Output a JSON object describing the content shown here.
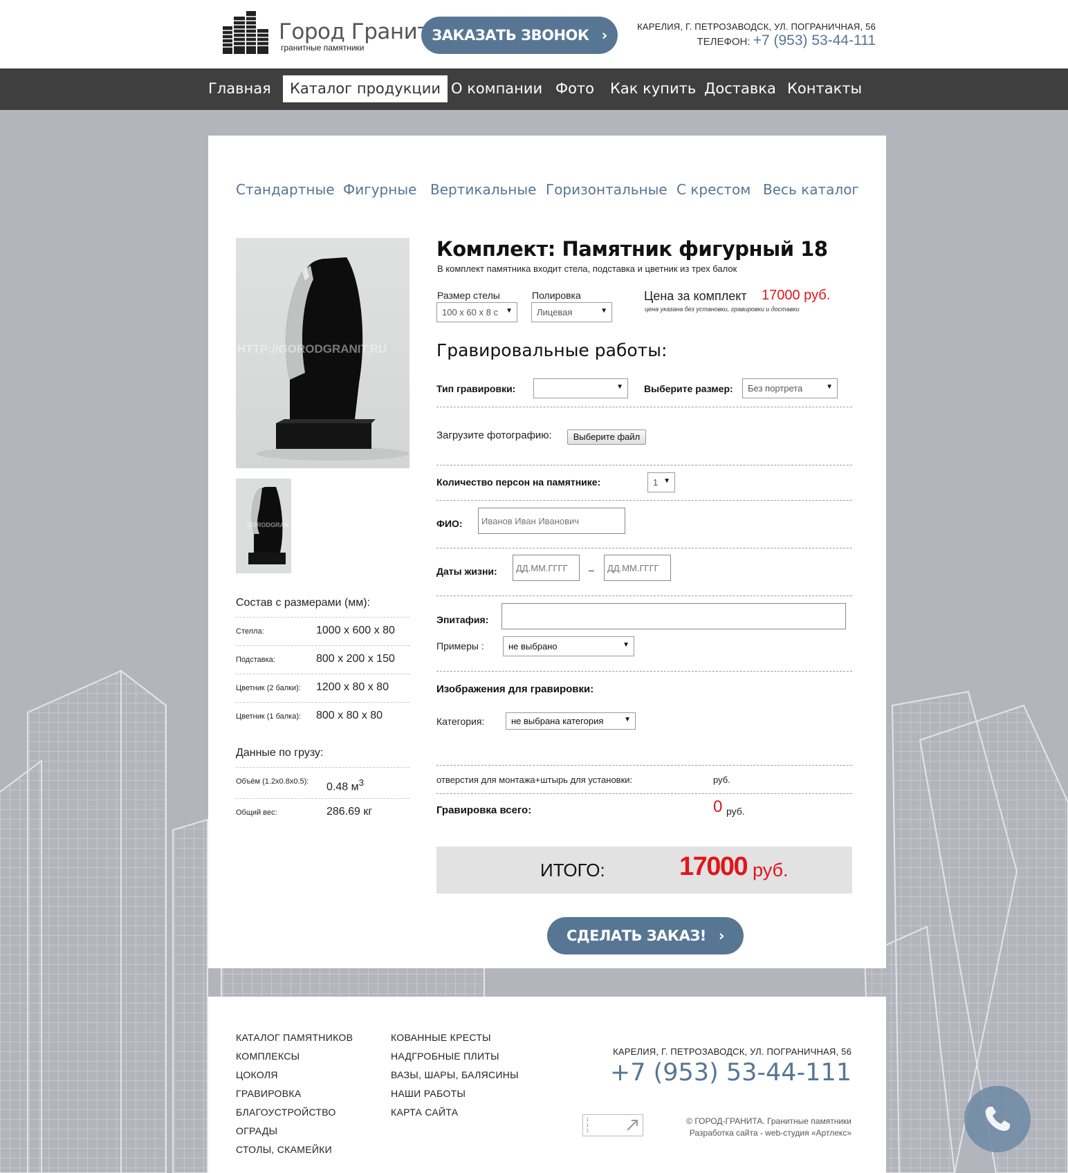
{
  "header": {
    "logo_title": "Город Гранит",
    "logo_subtitle": "гранитные памятники",
    "call_button": "ЗАКАЗАТЬ ЗВОНОК",
    "address": "КАРЕЛИЯ, Г. ПЕТРОЗАВОДСК, УЛ. ПОГРАНИЧНАЯ, 56",
    "phone_label": "ТЕЛЕФОН:",
    "phone": "+7 (953) 53-44-111"
  },
  "nav": {
    "items": [
      {
        "label": "Главная",
        "active": false
      },
      {
        "label": "Каталог продукции",
        "active": true
      },
      {
        "label": "О компании",
        "active": false
      },
      {
        "label": "Фото",
        "active": false
      },
      {
        "label": "Как купить",
        "active": false
      },
      {
        "label": "Доставка",
        "active": false
      },
      {
        "label": "Контакты",
        "active": false
      }
    ]
  },
  "subnav": {
    "items": [
      "Стандартные",
      "Фигурные",
      "Вертикальные",
      "Горизонтальные",
      "С крестом",
      "Весь каталог"
    ]
  },
  "gallery": {
    "watermark": "HTTP://GORODGRANIT.RU",
    "thumb_watermark": "GORODGRAN"
  },
  "specs": {
    "title": "Состав с размерами (мм):",
    "rows": [
      {
        "key": "Стелла:",
        "value": "1000 x 600 x 80"
      },
      {
        "key": "Подставка:",
        "value": "800 x 200 x 150"
      },
      {
        "key": "Цветник (2 балки):",
        "value": "1200 x 80 x 80"
      },
      {
        "key": "Цветник (1 балка):",
        "value": "800 x 80 x 80"
      }
    ],
    "cargo_title": "Данные по грузу:",
    "cargo_rows": [
      {
        "key": "Объём (1.2x0.8x0.5):",
        "value": "0.48 м",
        "sup": "3"
      },
      {
        "key": "Общий вес:",
        "value": "286.69 кг",
        "sup": ""
      }
    ]
  },
  "product": {
    "title": "Комплект: Памятник фигурный 18",
    "description": "В комплект памятника входит стела, подставка и цветник из трех балок",
    "size_label": "Размер стелы",
    "size_value": "100 x 60 x 8 с",
    "polish_label": "Полировка",
    "polish_value": "Лицевая",
    "price_label": "Цена за комплект",
    "price_value": "17000 руб.",
    "price_note": "цена указана без установки, гравировки и доставки"
  },
  "engraving": {
    "heading": "Гравировальные работы:",
    "type_label": "Тип гравировки:",
    "type_value": "",
    "size_label": "Выберите размер:",
    "size_value": "Без портрета",
    "upload_label": "Загрузите фотографию:",
    "upload_button": "Выберите файл",
    "persons_label": "Количество персон на памятнике:",
    "persons_value": "1",
    "fio_label": "ФИО:",
    "fio_placeholder": "Иванов Иван Иванович",
    "dates_label": "Даты жизни:",
    "date_placeholder": "ДД.ММ.ГГГГ",
    "date_dash": "–",
    "epitaph_label": "Эпитафия:",
    "examples_label": "Примеры :",
    "examples_value": "не выбрано",
    "images_heading": "Изображения для гравировки:",
    "category_label": "Категория:",
    "category_value": "не выбрана категория",
    "holes_label": "отверстия для монтажа+штырь для установки:",
    "holes_value": "руб.",
    "total_label": "Гравировка всего:",
    "total_value": "0",
    "total_currency": "руб."
  },
  "totals": {
    "label": "ИТОГО:",
    "value": "17000",
    "currency": "руб."
  },
  "order_button": "СДЕЛАТЬ ЗАКАЗ!",
  "footer": {
    "col1": [
      "КАТАЛОГ ПАМЯТНИКОВ",
      "КОМПЛЕКСЫ",
      "ЦОКОЛЯ",
      "ГРАВИРОВКА",
      "БЛАГОУСТРОЙСТВО",
      "ОГРАДЫ",
      "СТОЛЫ, СКАМЕЙКИ"
    ],
    "col2": [
      "КОВАННЫЕ КРЕСТЫ",
      "НАДГРОБНЫЕ ПЛИТЫ",
      "ВАЗЫ, ШАРЫ, БАЛЯСИНЫ",
      "НАШИ РАБОТЫ",
      "КАРТА САЙТА"
    ],
    "address": "КАРЕЛИЯ, Г. ПЕТРОЗАВОДСК, УЛ. ПОГРАНИЧНАЯ, 56",
    "phone": "+7 (953) 53-44-111",
    "copyright": "© ГОРОД-ГРАНИТА. Гранитные памятники",
    "developer": "Разработка сайта - web-студия «Артлекс»"
  },
  "colors": {
    "accent": "#567694",
    "price": "#e0161b",
    "nav_bg": "#3f3f3f",
    "page_bg": "#b3b5bd"
  },
  "icons": {
    "logo": "buildings-icon",
    "call_arrow": "chevron-right-icon",
    "fab": "phone-icon"
  }
}
